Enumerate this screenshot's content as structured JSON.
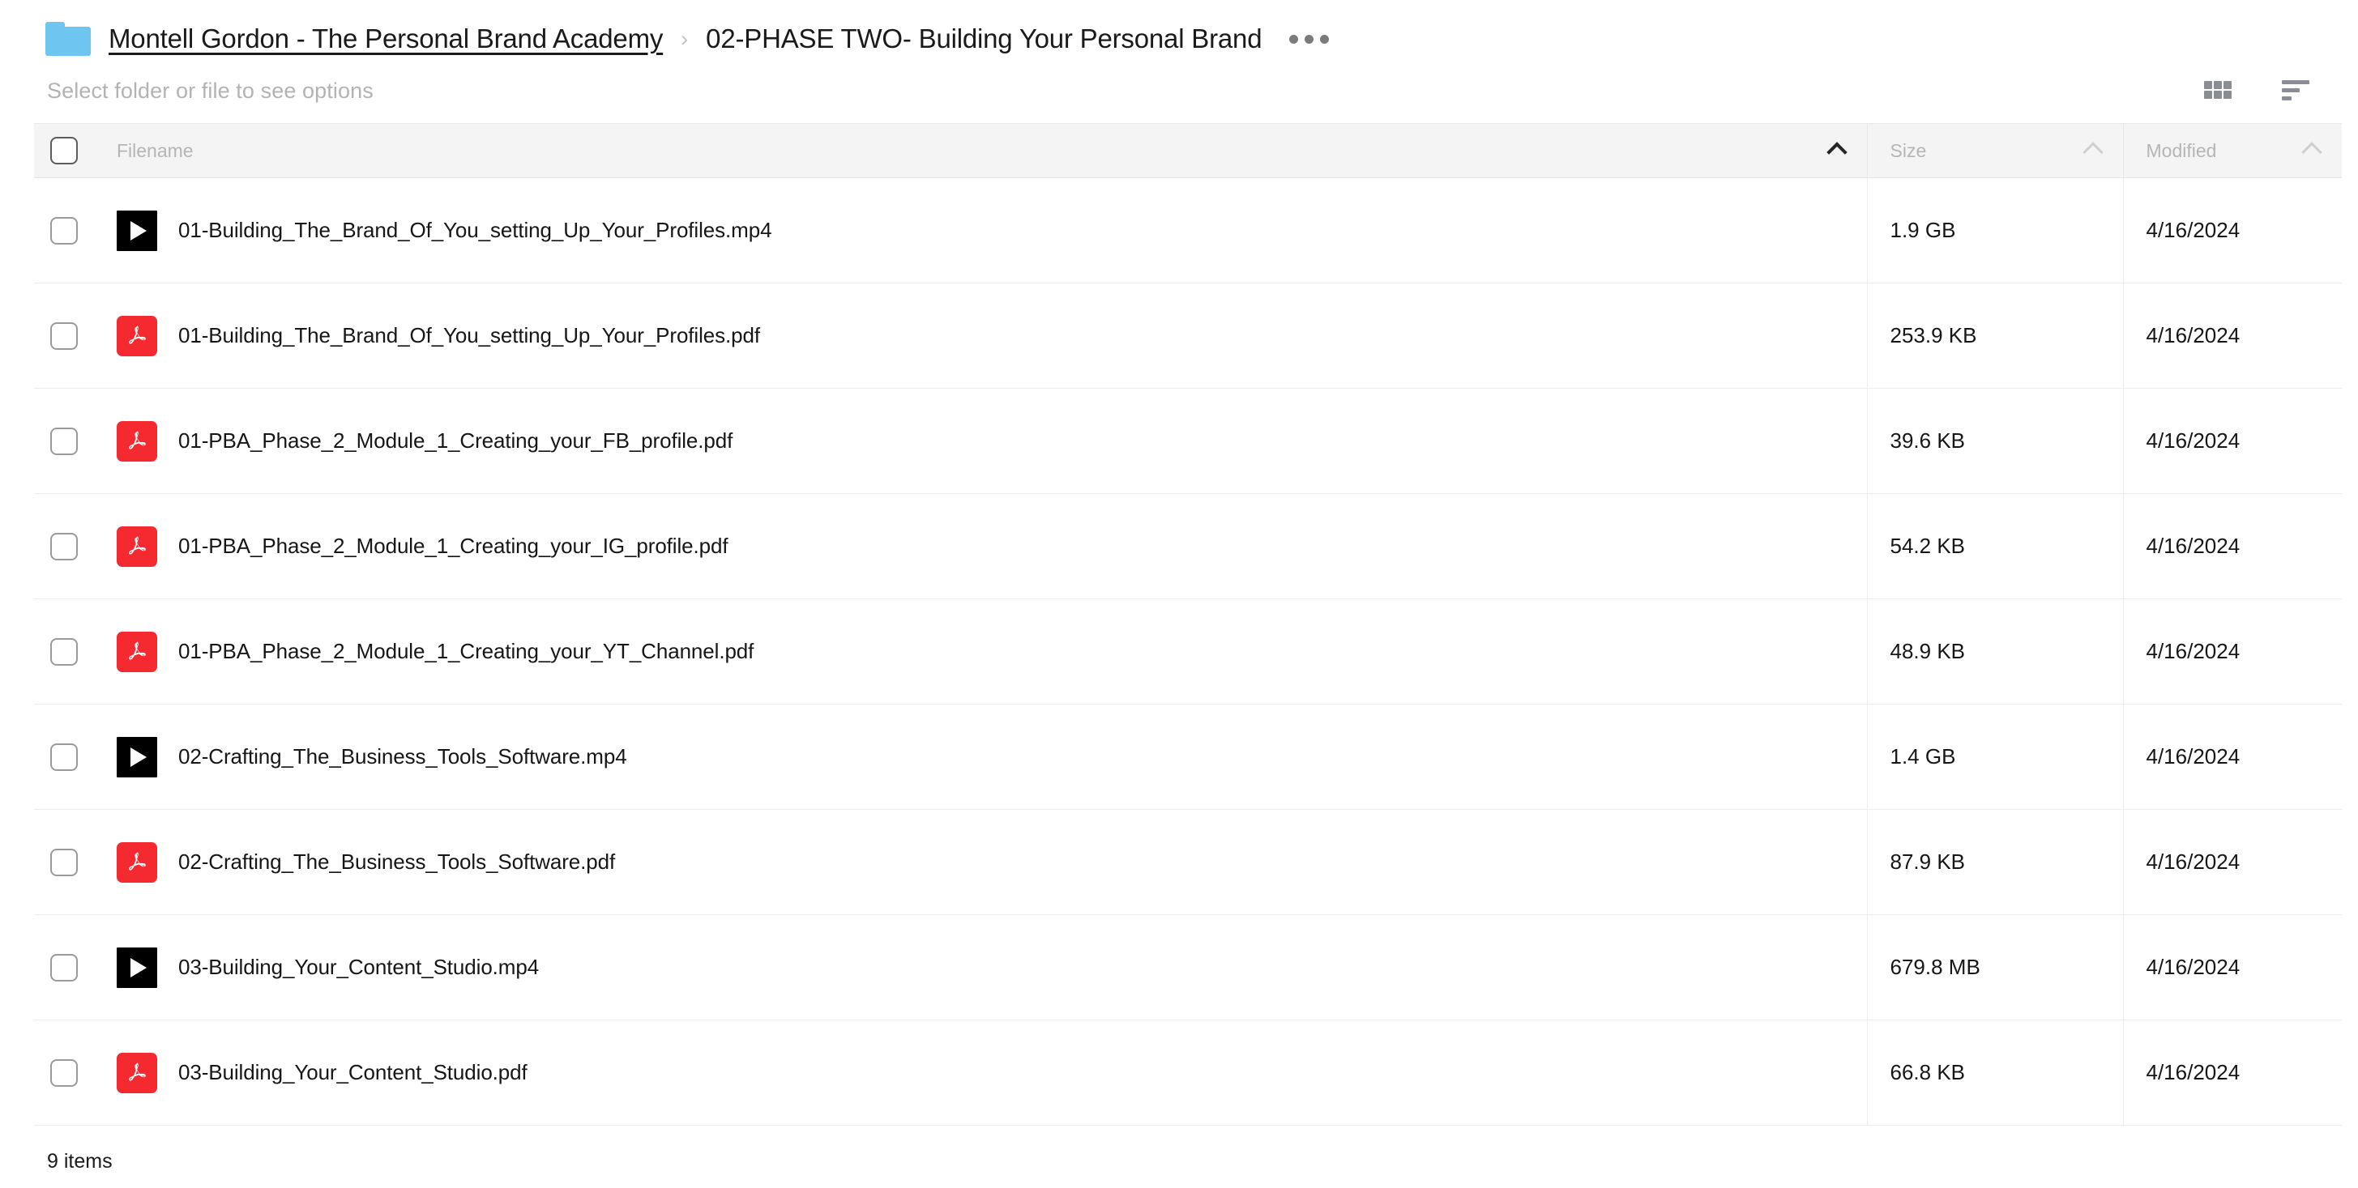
{
  "breadcrumb": {
    "folder_icon": "folder-icon",
    "root_label": "Montell Gordon - The Personal Brand Academy",
    "separator": "›",
    "current_label": "02-PHASE TWO- Building Your Personal Brand",
    "more_label": "more-options"
  },
  "toolbar": {
    "hint": "Select folder or file to see options",
    "grid_view_icon": "grid-view-icon",
    "sort_icon": "sort-list-icon"
  },
  "table": {
    "columns": {
      "filename": "Filename",
      "size": "Size",
      "modified": "Modified"
    },
    "sort": {
      "active_column": "Filename",
      "direction": "ascending"
    },
    "rows": [
      {
        "type": "video",
        "filename": "01-Building_The_Brand_Of_You_setting_Up_Your_Profiles.mp4",
        "size": "1.9 GB",
        "modified": "4/16/2024"
      },
      {
        "type": "pdf",
        "filename": "01-Building_The_Brand_Of_You_setting_Up_Your_Profiles.pdf",
        "size": "253.9 KB",
        "modified": "4/16/2024"
      },
      {
        "type": "pdf",
        "filename": "01-PBA_Phase_2_Module_1_Creating_your_FB_profile.pdf",
        "size": "39.6 KB",
        "modified": "4/16/2024"
      },
      {
        "type": "pdf",
        "filename": "01-PBA_Phase_2_Module_1_Creating_your_IG_profile.pdf",
        "size": "54.2 KB",
        "modified": "4/16/2024"
      },
      {
        "type": "pdf",
        "filename": "01-PBA_Phase_2_Module_1_Creating_your_YT_Channel.pdf",
        "size": "48.9 KB",
        "modified": "4/16/2024"
      },
      {
        "type": "video",
        "filename": "02-Crafting_The_Business_Tools_Software.mp4",
        "size": "1.4 GB",
        "modified": "4/16/2024"
      },
      {
        "type": "pdf",
        "filename": "02-Crafting_The_Business_Tools_Software.pdf",
        "size": "87.9 KB",
        "modified": "4/16/2024"
      },
      {
        "type": "video",
        "filename": "03-Building_Your_Content_Studio.mp4",
        "size": "679.8 MB",
        "modified": "4/16/2024"
      },
      {
        "type": "pdf",
        "filename": "03-Building_Your_Content_Studio.pdf",
        "size": "66.8 KB",
        "modified": "4/16/2024"
      }
    ]
  },
  "footer": {
    "item_count": "9 items"
  },
  "colors": {
    "folder": "#6ec6f0",
    "pdf": "#f42a30",
    "video": "#000000",
    "header_bg": "#f4f4f4",
    "muted_text": "#b5b5b5"
  }
}
